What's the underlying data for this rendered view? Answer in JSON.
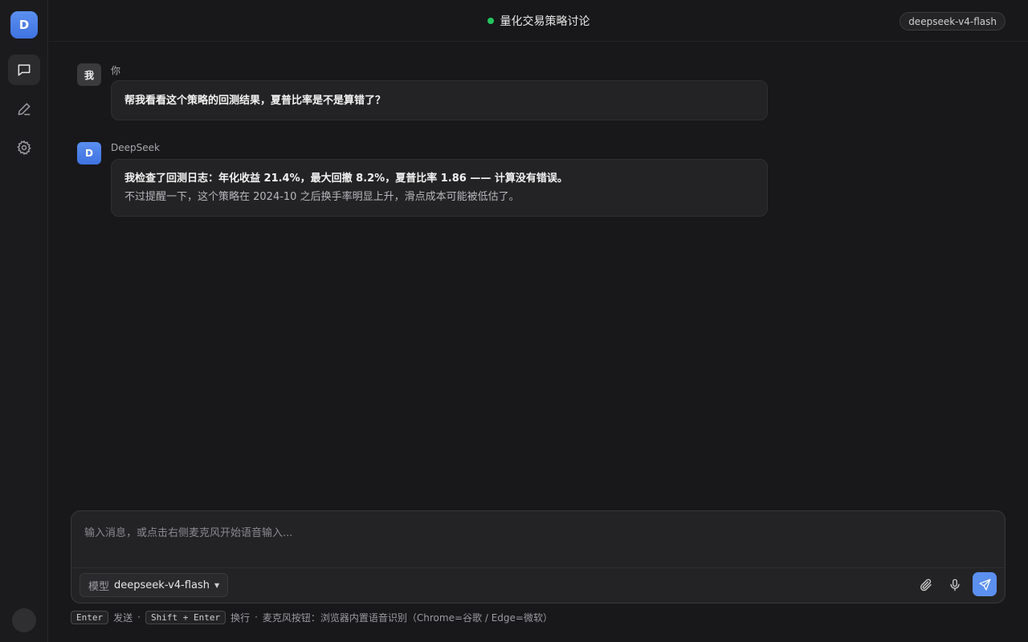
{
  "sidebar": {
    "logo_letter": "D",
    "nav": [
      {
        "name": "chat",
        "icon": "chat-bubble-icon",
        "active": true
      },
      {
        "name": "edit",
        "icon": "pen-icon",
        "active": false
      },
      {
        "name": "settings",
        "icon": "gear-icon",
        "active": false
      }
    ]
  },
  "header": {
    "title": "量化交易策略讨论",
    "status_color": "#22c55e",
    "model_badge": "deepseek-v4-flash"
  },
  "messages": [
    {
      "role": "user",
      "avatar": "我",
      "sender": "你",
      "lines": [
        "帮我看看这个策略的回测结果，夏普比率是不是算错了？"
      ]
    },
    {
      "role": "assistant",
      "avatar": "D",
      "sender": "DeepSeek",
      "lines": [
        "我检查了回测日志：年化收益 21.4%，最大回撤 8.2%，夏普比率 1.86 —— 计算没有错误。",
        "不过提醒一下，这个策略在 2024-10 之后换手率明显上升，滑点成本可能被低估了。"
      ]
    }
  ],
  "composer": {
    "placeholder": "输入消息，或点击右侧麦克风开始语音输入...",
    "value": "",
    "model_label": "模型",
    "model_value": "deepseek-v4-flash",
    "accent": "#5b8ff0",
    "icons": [
      "paperclip-icon",
      "microphone-icon",
      "send-icon"
    ]
  },
  "hint": {
    "enter_key": "Enter",
    "enter_action": "发送",
    "sep": "·",
    "shift_key": "Shift + Enter",
    "shift_action": "换行",
    "mic_note": "麦克风按钮：浏览器内置语音识别（Chrome=谷歌 / Edge=微软）"
  }
}
